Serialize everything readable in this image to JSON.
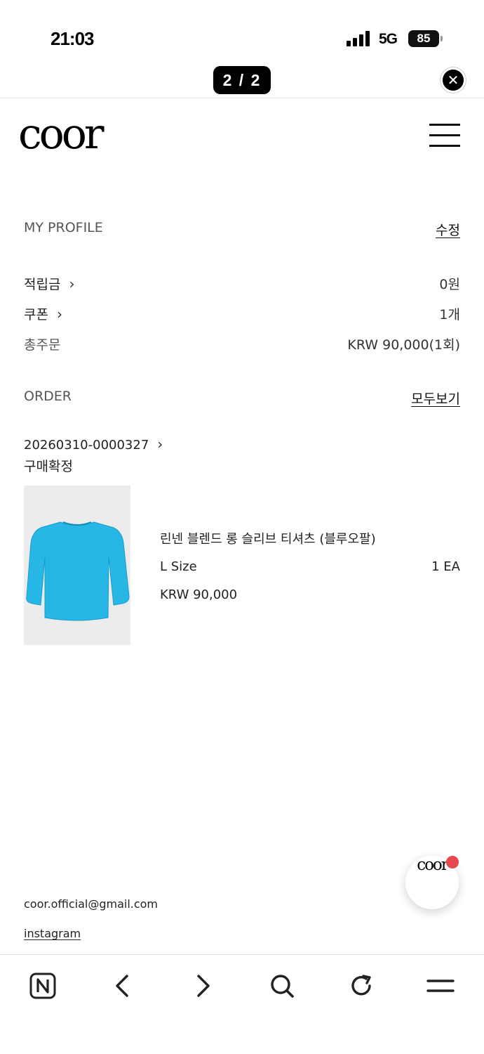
{
  "status_bar": {
    "time": "21:03",
    "network": "5G",
    "battery": "85"
  },
  "viewer": {
    "page_counter": "2 / 2"
  },
  "header": {
    "logo": "coor"
  },
  "profile": {
    "title": "MY PROFILE",
    "edit_link": "수정",
    "rows": [
      {
        "label": "적립금",
        "value": "0원"
      },
      {
        "label": "쿠폰",
        "value": "1개"
      },
      {
        "label": "총주문",
        "value": "KRW 90,000(1회)"
      }
    ]
  },
  "order": {
    "title": "ORDER",
    "view_all": "모두보기",
    "number": "20260310-0000327",
    "status": "구매확정",
    "item": {
      "name": "린넨 블렌드 롱 슬리브 티셔츠 (블루오팔)",
      "option": "L Size",
      "quantity": "1 EA",
      "price": "KRW 90,000",
      "garment_color": "#27b7e6"
    }
  },
  "footer": {
    "email": "coor.official@gmail.com",
    "instagram": "instagram"
  },
  "chat_fab": {
    "label": "coor",
    "badge_color": "#e5484d"
  },
  "browser_bar": {
    "icons": [
      "naver-n-icon",
      "back-icon",
      "forward-icon",
      "search-icon",
      "reload-icon",
      "menu-icon"
    ]
  }
}
